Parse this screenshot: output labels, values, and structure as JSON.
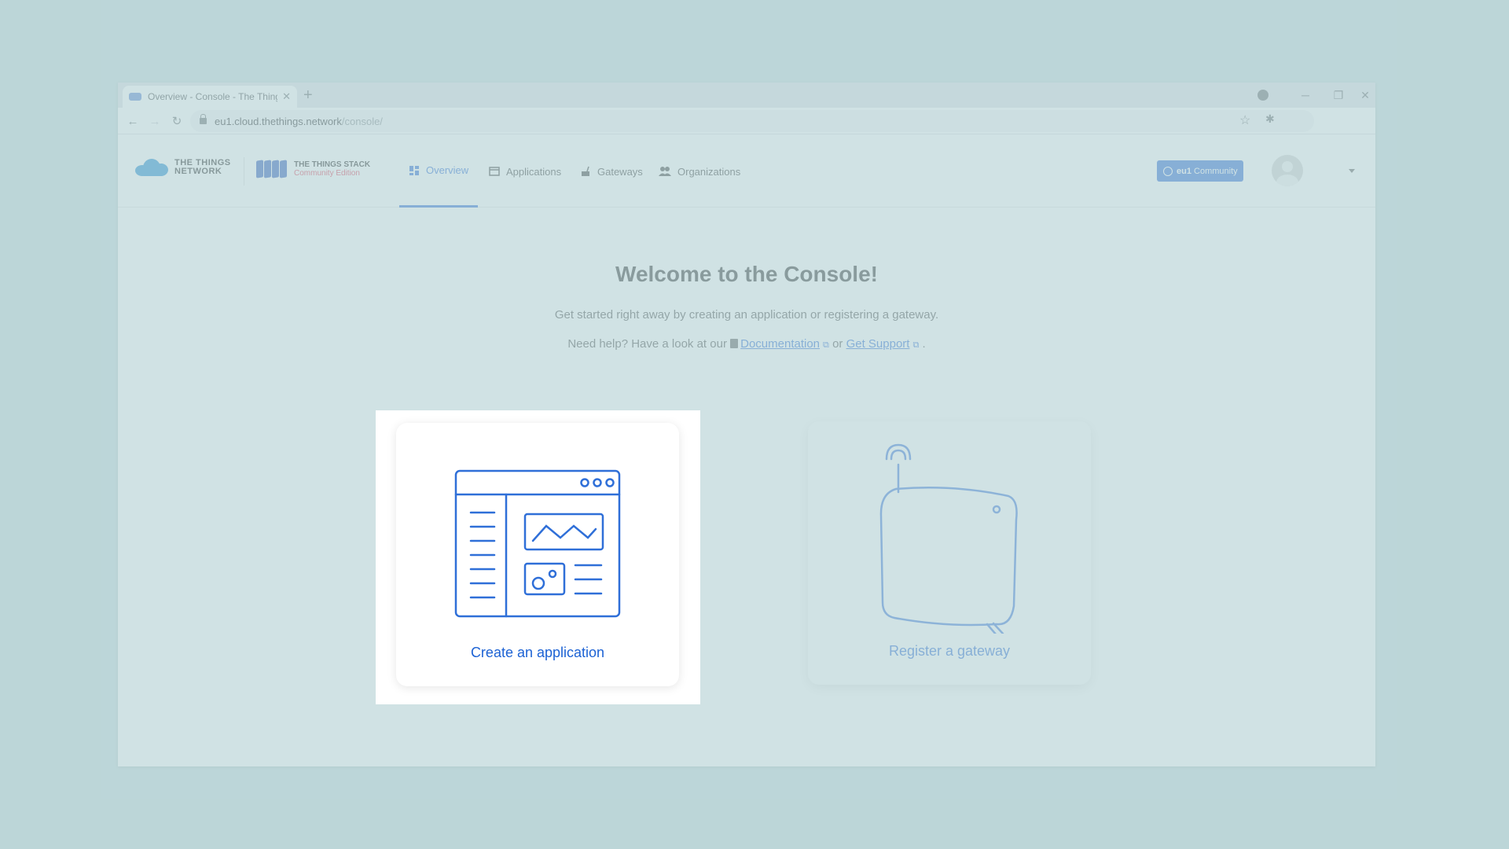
{
  "browser": {
    "tab_title": "Overview - Console - The Things",
    "url_host": "eu1.cloud.thethings.network",
    "url_path": "/console/"
  },
  "header": {
    "ttn_logo_line1": "THE THINGS",
    "ttn_logo_line2": "NETWORK",
    "tts_logo_title": "THE THINGS STACK",
    "tts_logo_sub": "Community Edition",
    "nav": [
      {
        "label": "Overview",
        "icon": "dashboard-icon",
        "active": true
      },
      {
        "label": "Applications",
        "icon": "application-icon"
      },
      {
        "label": "Gateways",
        "icon": "gateway-icon"
      },
      {
        "label": "Organizations",
        "icon": "organizations-icon"
      }
    ],
    "cluster_badge": {
      "cluster": "eu1",
      "tier": "Community"
    }
  },
  "main": {
    "title": "Welcome to the Console!",
    "subtitle": "Get started right away by creating an application or registering a gateway.",
    "help_prefix": "Need help? Have a look at our",
    "doc_link": "Documentation",
    "or_text": "or",
    "support_link": "Get Support",
    "period": ".",
    "cards": [
      {
        "label": "Create an application",
        "icon": "application-illustration-icon",
        "highlighted": true
      },
      {
        "label": "Register a gateway",
        "icon": "gateway-illustration-icon",
        "highlighted": false
      }
    ]
  },
  "colors": {
    "accent": "#1c62d4",
    "backdrop": "#c2d9db"
  }
}
